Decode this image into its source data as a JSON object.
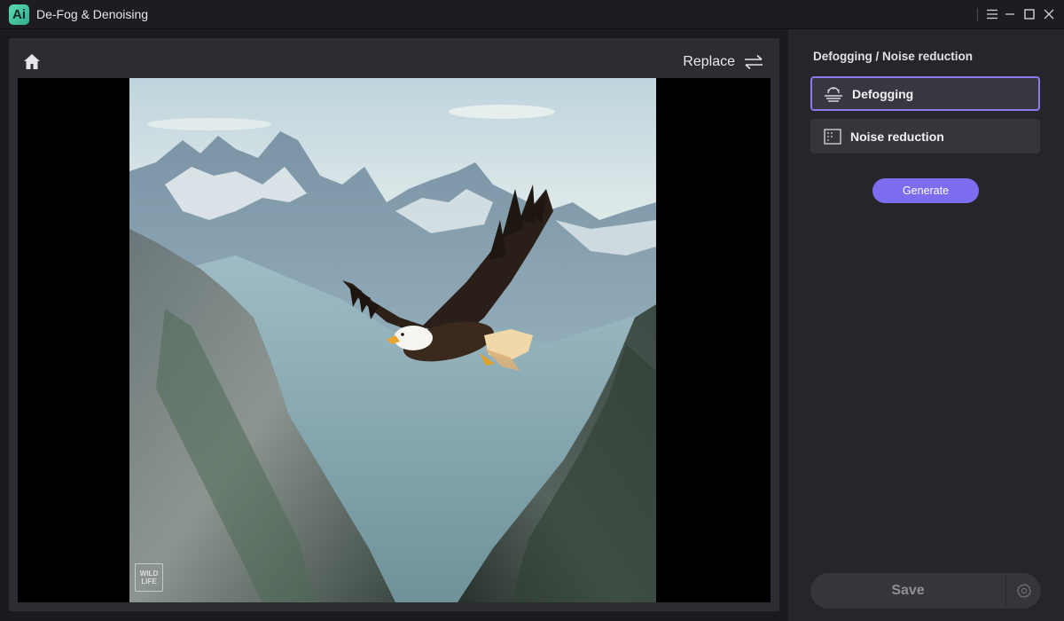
{
  "app": {
    "icon_text": "Ai",
    "title": "De-Fog & Denoising"
  },
  "window_controls": [
    "menu-icon",
    "minimize-icon",
    "maximize-icon",
    "close-icon"
  ],
  "toolbar": {
    "home_icon": "home-icon",
    "replace_label": "Replace",
    "replace_icon": "swap-icon"
  },
  "image": {
    "subject": "bald eagle soaring over mountains",
    "watermark": "WILD LIFE"
  },
  "panel": {
    "title": "Defogging / Noise reduction",
    "options": [
      {
        "label": "Defogging",
        "icon": "fog-icon",
        "selected": true
      },
      {
        "label": "Noise reduction",
        "icon": "noise-grid-icon",
        "selected": false
      }
    ],
    "generate_label": "Generate",
    "save_label": "Save",
    "save_settings_icon": "gear-icon"
  },
  "colors": {
    "accent": "#7b6cf0",
    "selected_border": "#8a79f0",
    "background": "#1b1b1f",
    "panel": "#25252a"
  }
}
